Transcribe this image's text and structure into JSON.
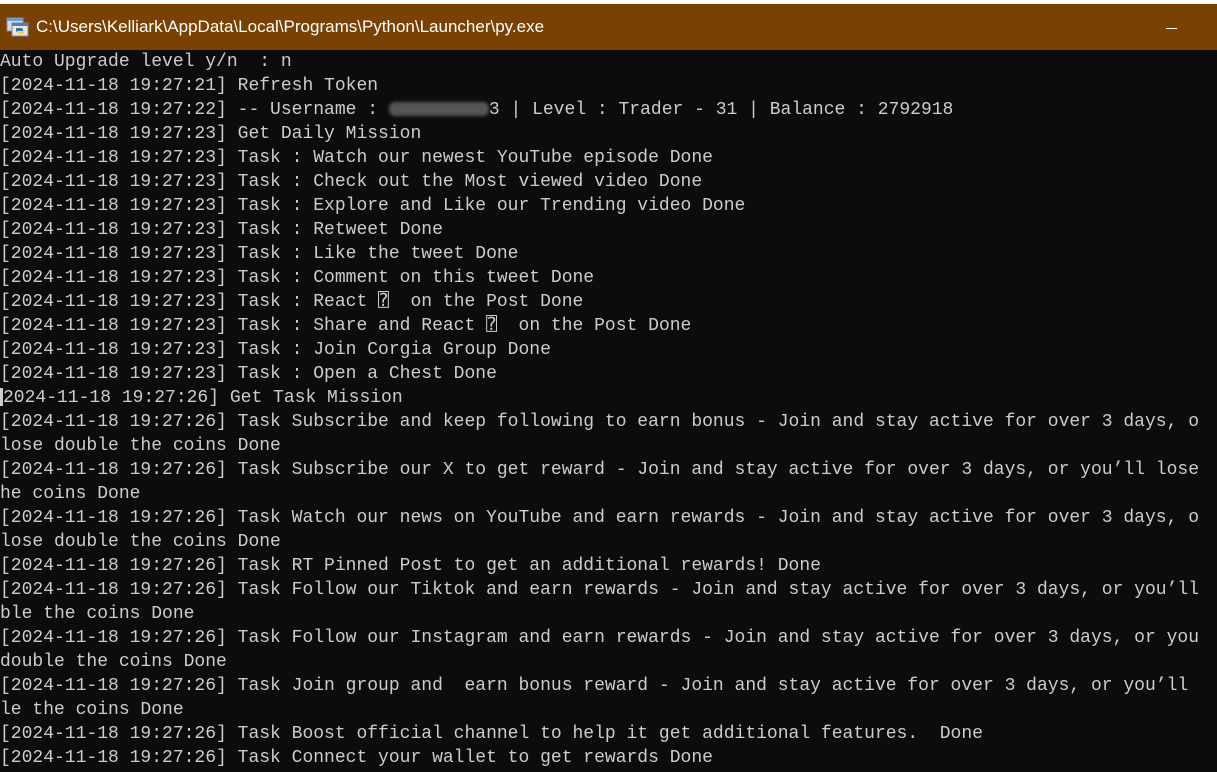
{
  "window": {
    "title": "C:\\Users\\Kelliark\\AppData\\Local\\Programs\\Python\\Launcher\\py.exe",
    "app_icon": "python-launcher-icon",
    "minimize_icon": "minimize-icon",
    "titlebar_color": "#7a4104"
  },
  "console": {
    "lines": [
      "Auto Upgrade level y/n  : n",
      "[2024-11-18 19:27:21] Refresh Token",
      "[2024-11-18 19:27:22] -- Username :",
      "[2024-11-18 19:27:23] Get Daily Mission",
      "[2024-11-18 19:27:23] Task : Watch our newest YouTube episode Done",
      "[2024-11-18 19:27:23] Task : Check out the Most viewed video Done",
      "[2024-11-18 19:27:23] Task : Explore and Like our Trending video Done",
      "[2024-11-18 19:27:23] Task : Retweet Done",
      "[2024-11-18 19:27:23] Task : Like the tweet Done",
      "[2024-11-18 19:27:23] Task : Comment on this tweet Done",
      "[2024-11-18 19:27:23] Task : React ⍰  on the Post Done",
      "[2024-11-18 19:27:23] Task : Share and React ⍰  on the Post Done",
      "[2024-11-18 19:27:23] Task : Join Corgia Group Done",
      "[2024-11-18 19:27:23] Task : Open a Chest Done",
      "2024-11-18 19:27:26] Get Task Mission",
      "[2024-11-18 19:27:26] Task Subscribe and keep following to earn bonus - Join and stay active for over 3 days, o",
      "lose double the coins Done",
      "[2024-11-18 19:27:26] Task Subscribe our X to get reward - Join and stay active for over 3 days, or you’ll lose",
      "he coins Done",
      "[2024-11-18 19:27:26] Task Watch our news on YouTube and earn rewards - Join and stay active for over 3 days, o",
      "lose double the coins Done",
      "[2024-11-18 19:27:26] Task RT Pinned Post to get an additional rewards! Done",
      "[2024-11-18 19:27:26] Task Follow our Tiktok and earn rewards - Join and stay active for over 3 days, or you’ll",
      "ble the coins Done",
      "[2024-11-18 19:27:26] Task Follow our Instagram and earn rewards - Join and stay active for over 3 days, or you",
      "double the coins Done",
      "[2024-11-18 19:27:26] Task Join group and  earn bonus reward - Join and stay active for over 3 days, or you’ll",
      "le the coins Done",
      "[2024-11-18 19:27:26] Task Boost official channel to help it get additional features.  Done",
      "[2024-11-18 19:27:26] Task Connect your wallet to get rewards Done"
    ],
    "username_suffix": "3 | Level : Trader - 31 | Balance : 2792918"
  },
  "colors": {
    "console_bg": "#0c0c0c",
    "console_text": "#cccccc"
  }
}
